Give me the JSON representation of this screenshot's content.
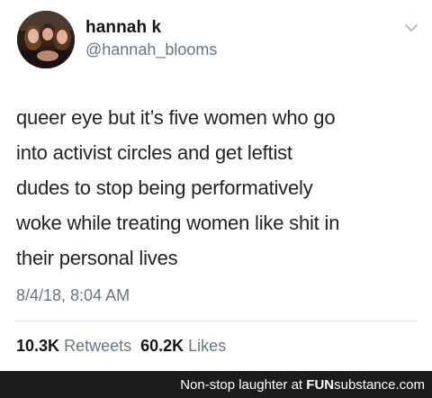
{
  "user": {
    "display_name": "hannah k",
    "handle": "@hannah_blooms",
    "avatar_icon": "profile-photo-avatar"
  },
  "menu_icon": "chevron-down-icon",
  "tweet": {
    "lines": [
      "queer eye but it’s five women who go",
      "into activist circles and get leftist",
      "dudes to stop being performatively",
      "woke while treating women like shit in",
      "their personal lives"
    ],
    "timestamp": "8/4/18, 8:04 AM"
  },
  "stats": {
    "retweets_count": "10.3K",
    "retweets_label": "Retweets",
    "likes_count": "60.2K",
    "likes_label": "Likes"
  },
  "footer": {
    "caption": "Non-stop laughter at ",
    "brand_bold": "FUN",
    "brand_rest": "substance.com"
  },
  "colors": {
    "text": "#14171a",
    "secondary": "#657786",
    "divider": "#e1e8ed",
    "footer_bg": "#1c1c1c"
  }
}
